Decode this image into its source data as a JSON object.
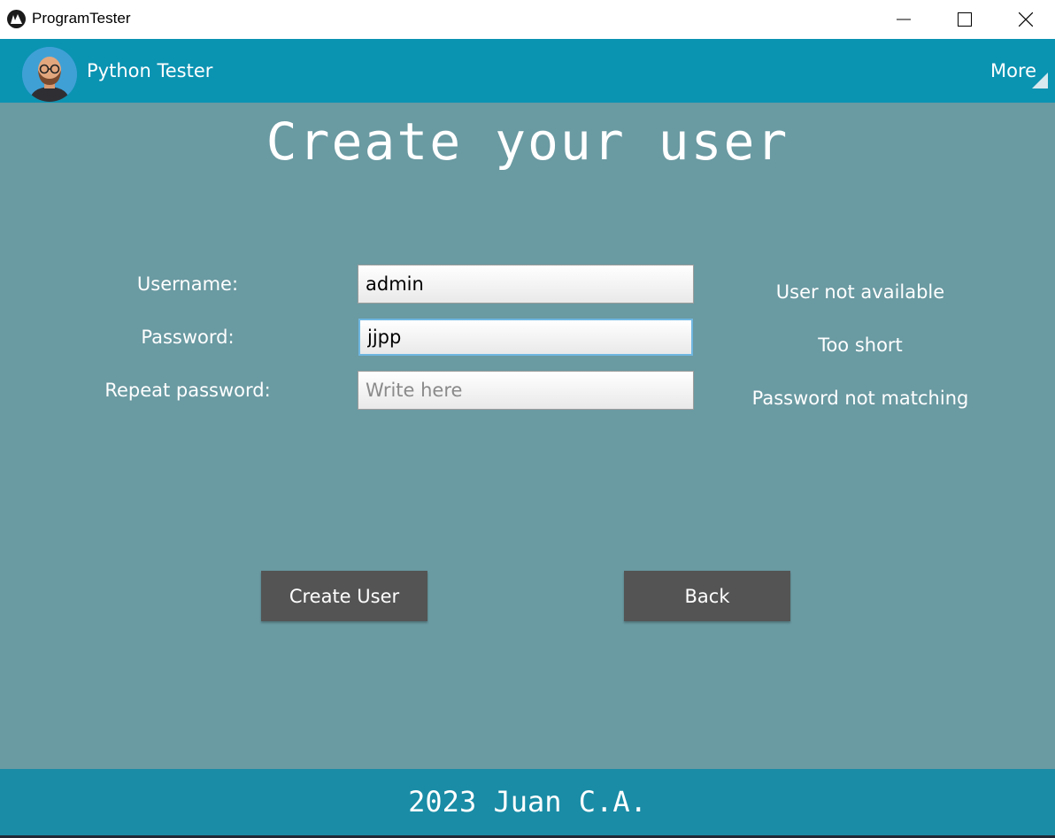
{
  "window": {
    "title": "ProgramTester"
  },
  "header": {
    "app_title": "Python Tester",
    "more_label": "More"
  },
  "main": {
    "heading": "Create your user"
  },
  "form": {
    "username": {
      "label": "Username:",
      "value": "admin",
      "status": "User not available"
    },
    "password": {
      "label": "Password:",
      "value": "jjpp",
      "status": "Too short"
    },
    "repeat_password": {
      "label": "Repeat password:",
      "value": "",
      "placeholder": "Write here",
      "status": "Password not matching"
    }
  },
  "actions": {
    "create_label": "Create User",
    "back_label": "Back"
  },
  "footer": {
    "text": "2023 Juan C.A."
  },
  "colors": {
    "background": "#6a9aa2",
    "header": "#0b93b2",
    "footer": "#1a8ca6",
    "button": "#545454"
  }
}
